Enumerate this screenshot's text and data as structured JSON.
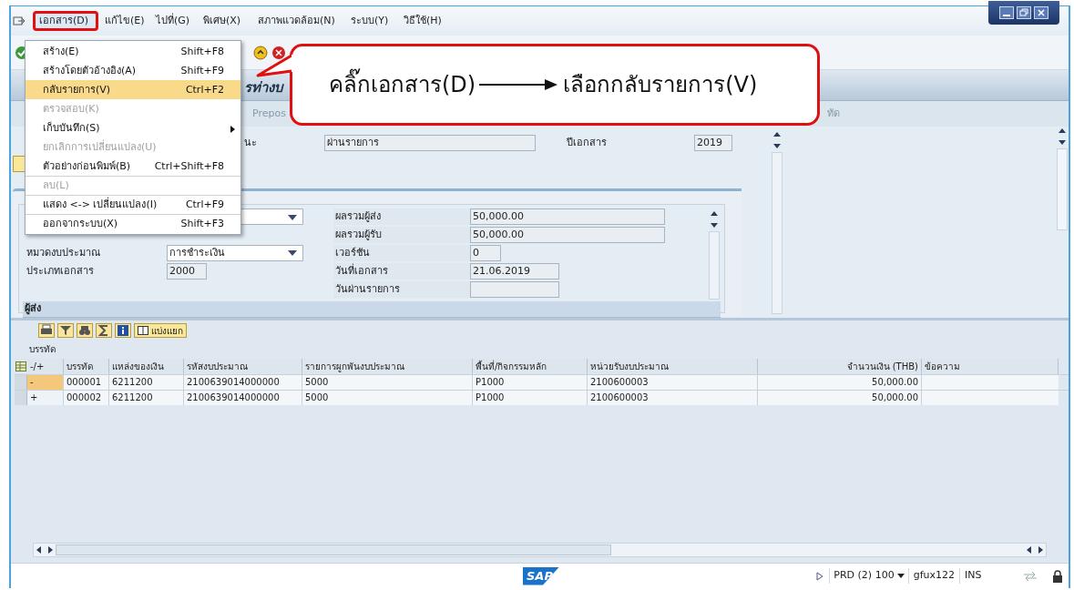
{
  "menu_bar": [
    {
      "label": "เอกสาร(D)",
      "selected": true
    },
    {
      "label": "แก้ไข(E)",
      "selected": false
    },
    {
      "label": "ไปที่(G)",
      "selected": false
    },
    {
      "label": "พิเศษ(X)",
      "selected": false
    },
    {
      "label": "สภาพแวดล้อม(N)",
      "selected": false
    },
    {
      "label": "ระบบ(Y)",
      "selected": false
    },
    {
      "label": "วิธีใช้(H)",
      "selected": false
    }
  ],
  "menu": [
    {
      "label": "สร้าง(E)",
      "shortcut": "Shift+F8",
      "selected": false,
      "disabled": false,
      "submenu": false,
      "divider_above": false
    },
    {
      "label": "สร้างโดยตัวอ้างอิง(A)",
      "shortcut": "Shift+F9",
      "selected": false,
      "disabled": false,
      "submenu": false,
      "divider_above": false
    },
    {
      "label": "กลับรายการ(V)",
      "shortcut": "Ctrl+F2",
      "selected": true,
      "disabled": false,
      "submenu": false,
      "divider_above": false
    },
    {
      "label": "ตรวจสอบ(K)",
      "selected": false,
      "disabled": true,
      "submenu": false,
      "divider_above": false
    },
    {
      "label": "เก็บบันทึก(S)",
      "selected": false,
      "disabled": false,
      "submenu": true,
      "divider_above": false
    },
    {
      "label": "ยกเลิกการเปลี่ยนแปลง(U)",
      "selected": false,
      "disabled": true,
      "submenu": false,
      "divider_above": false
    },
    {
      "label": "ตัวอย่างก่อนพิมพ์(B)",
      "shortcut": "Ctrl+Shift+F8",
      "selected": false,
      "disabled": false,
      "submenu": false,
      "divider_above": false
    },
    {
      "label": "ลบ(L)",
      "selected": false,
      "disabled": true,
      "submenu": false,
      "divider_above": true
    },
    {
      "label": "แสดง <-> เปลี่ยนแปลง(I)",
      "shortcut": "Ctrl+F9",
      "selected": false,
      "disabled": false,
      "submenu": false,
      "divider_above": true
    },
    {
      "label": "ออกจากระบบ(X)",
      "shortcut": "Shift+F3",
      "selected": false,
      "disabled": false,
      "submenu": false,
      "divider_above": true
    }
  ],
  "callout": {
    "step_1": "คลิ๊กเอกสาร(D)",
    "step_2": "เลือกกลับรายการ(V)"
  },
  "title_visible": "รท่างบ",
  "app_toolbar": [
    "Prepos",
    "ทัด"
  ],
  "header": {
    "status_label": "นะ",
    "status_value": "ผ่านรายการ",
    "year_label": "ปีเอกสาร",
    "year_value": "2019"
  },
  "form": {
    "left": [
      {
        "label": "หมวดงบประมาณ",
        "value": "การชำระเงิน",
        "kind": "dropdown"
      },
      {
        "label": "ประเภทเอกสาร",
        "value": "2000",
        "kind": "field"
      }
    ],
    "right": [
      {
        "label": "ผลรวมผู้ส่ง",
        "value": "50,000.00"
      },
      {
        "label": "ผลรวมผู้รับ",
        "value": "50,000.00"
      },
      {
        "label": "เวอร์ชัน",
        "value": "0"
      },
      {
        "label": "วันที่เอกสาร",
        "value": "21.06.2019"
      },
      {
        "label": "วันผ่านรายการ"
      }
    ],
    "section": "ผู้ส่ง"
  },
  "items_toolbar": {
    "split_button": "แบ่งแยก"
  },
  "table": {
    "title": "บรรทัด",
    "columns": [
      "-/+",
      "บรรทัด",
      "แหล่งของเงิน",
      "รหัสงบประมาณ",
      "รายการผูกพันงบประมาณ",
      "พื้นที่/กิจกรรมหลัก",
      "หน่วยรับงบประมาณ",
      "จำนวนเงิน (THB)",
      "ข้อความ"
    ],
    "rows": [
      {
        "cells": [
          "-",
          "000001",
          "6211200",
          "2100639014000000",
          "5000",
          "P1000",
          "2100600003",
          "50,000.00"
        ],
        "current": true
      },
      {
        "cells": [
          "+",
          "000002",
          "6211200",
          "2100639014000000",
          "5000",
          "P1000",
          "2100600003",
          "50,000.00"
        ],
        "current": false
      }
    ]
  },
  "status_bar": {
    "logo": "SAP",
    "system": "PRD (2) 100",
    "user": "gfux122",
    "mode": "INS"
  }
}
